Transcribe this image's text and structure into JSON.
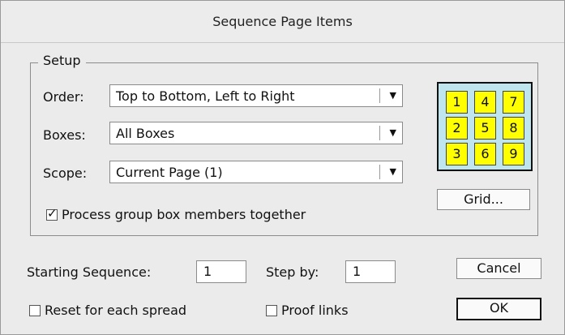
{
  "dialog": {
    "title": "Sequence Page Items"
  },
  "setup": {
    "legend": "Setup",
    "order": {
      "label": "Order:",
      "value": "Top to Bottom, Left to Right"
    },
    "boxes": {
      "label": "Boxes:",
      "value": "All Boxes"
    },
    "scope": {
      "label": "Scope:",
      "value": "Current Page (1)"
    },
    "process_group": {
      "label": "Process group box members together",
      "checked": true
    },
    "grid_preview": [
      "1",
      "4",
      "7",
      "2",
      "5",
      "8",
      "3",
      "6",
      "9"
    ],
    "grid_button": "Grid...",
    "dropdown_arrow": "▼",
    "check_mark": "✓"
  },
  "starting_sequence": {
    "label": "Starting Sequence:",
    "value": "1"
  },
  "step_by": {
    "label": "Step by:",
    "value": "1"
  },
  "reset_each_spread": {
    "label": "Reset for each spread",
    "checked": false
  },
  "proof_links": {
    "label": "Proof links",
    "checked": false
  },
  "buttons": {
    "cancel": "Cancel",
    "ok": "OK"
  },
  "colors": {
    "preview_bg": "#bfe6ef",
    "cell_bg": "#ffff00"
  }
}
